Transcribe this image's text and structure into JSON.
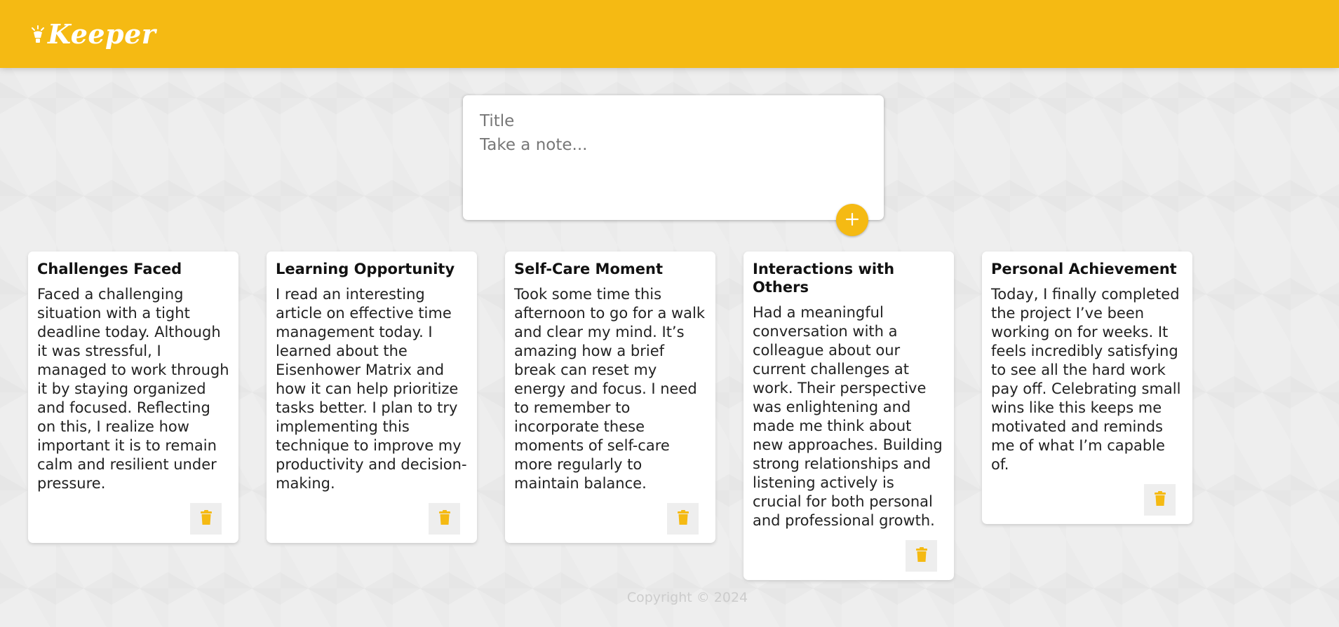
{
  "header": {
    "title": "Keeper",
    "logo_icon": "lightbulb-icon",
    "background_color": "#f5ba13"
  },
  "create_note": {
    "title_placeholder": "Title",
    "content_placeholder": "Take a note...",
    "add_icon": "plus-icon"
  },
  "notes": [
    {
      "title": "Challenges Faced",
      "content": "Faced a challenging situation with a tight deadline today. Although it was stressful, I managed to work through it by staying organized and focused. Reflecting on this, I realize how important it is to remain calm and resilient under pressure.",
      "delete_icon": "trash-icon"
    },
    {
      "title": "Learning Opportunity",
      "content": "I read an interesting article on effective time management today. I learned about the Eisenhower Matrix and how it can help prioritize tasks better. I plan to try implementing this technique to improve my productivity and decision-making.",
      "delete_icon": "trash-icon"
    },
    {
      "title": "Self-Care Moment",
      "content": "Took some time this afternoon to go for a walk and clear my mind. It’s amazing how a brief break can reset my energy and focus. I need to remember to incorporate these moments of self-care more regularly to maintain balance.",
      "delete_icon": "trash-icon"
    },
    {
      "title": "Interactions with Others",
      "content": "Had a meaningful conversation with a colleague about our current challenges at work. Their perspective was enlightening and made me think about new approaches. Building strong relationships and listening actively is crucial for both personal and professional growth.",
      "delete_icon": "trash-icon"
    },
    {
      "title": "Personal Achievement",
      "content": "Today, I finally completed the project I’ve been working on for weeks. It feels incredibly satisfying to see all the hard work pay off. Celebrating small wins like this keeps me motivated and reminds me of what I’m capable of.",
      "delete_icon": "trash-icon"
    }
  ],
  "footer": {
    "text": "Copyright © 2024"
  },
  "colors": {
    "accent": "#f5ba13",
    "background": "#eeeeee",
    "card": "#ffffff"
  }
}
